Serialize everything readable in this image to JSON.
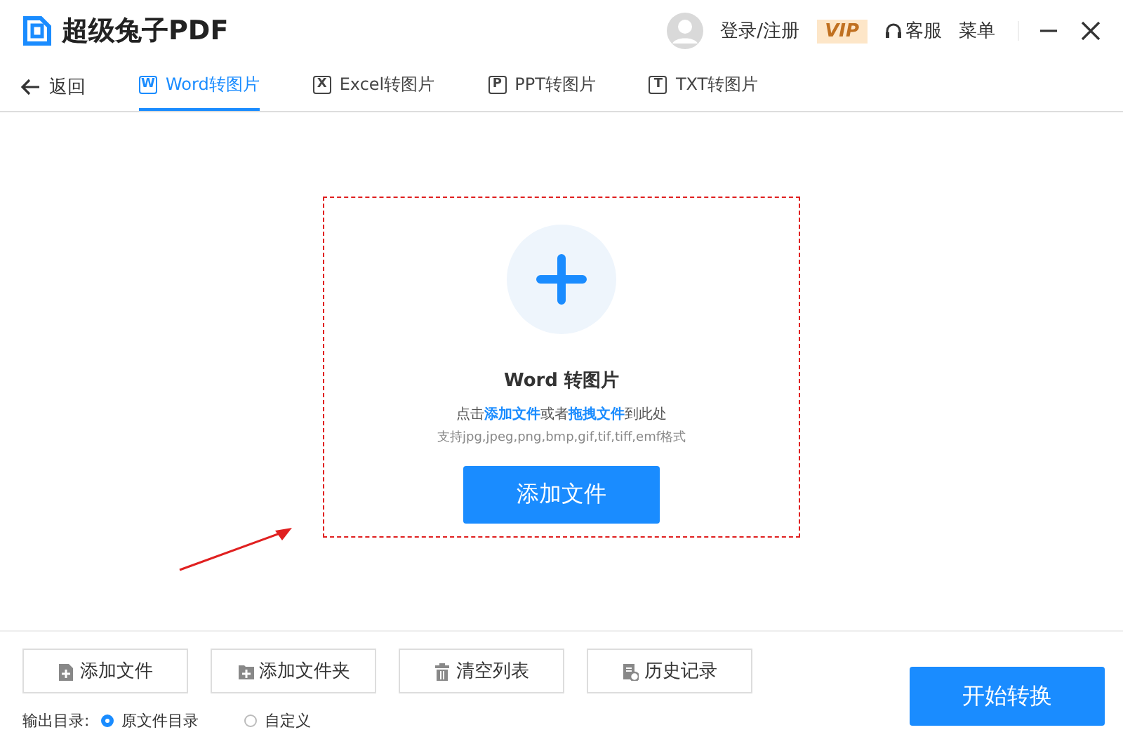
{
  "app": {
    "title": "超级兔子PDF"
  },
  "header": {
    "login": "登录/注册",
    "vip": "VIP",
    "service": "客服",
    "menu": "菜单"
  },
  "back": "返回",
  "tabs": [
    {
      "icon": "W",
      "label": "Word转图片",
      "selected": true
    },
    {
      "icon": "X",
      "label": "Excel转图片",
      "selected": false
    },
    {
      "icon": "P",
      "label": "PPT转图片",
      "selected": false
    },
    {
      "icon": "T",
      "label": "TXT转图片",
      "selected": false
    }
  ],
  "dropzone": {
    "title": "Word 转图片",
    "hint": "点击**添加文件**或者**拖拽文件**到此处",
    "formats": "支持jpg,jpeg,png,bmp,gif,tif,tiff,emf格式",
    "button": "添加文件"
  },
  "toolbar": [
    {
      "kind": "file",
      "label": "添加文件"
    },
    {
      "kind": "folder",
      "label": "添加文件夹"
    },
    {
      "kind": "trash",
      "label": "清空列表"
    },
    {
      "kind": "history",
      "label": "历史记录"
    }
  ],
  "output": {
    "label": "输出目录:",
    "options": [
      {
        "label": "原文件目录",
        "selected": true
      },
      {
        "label": "自定义",
        "selected": false
      }
    ]
  },
  "start_button": "开始转换"
}
